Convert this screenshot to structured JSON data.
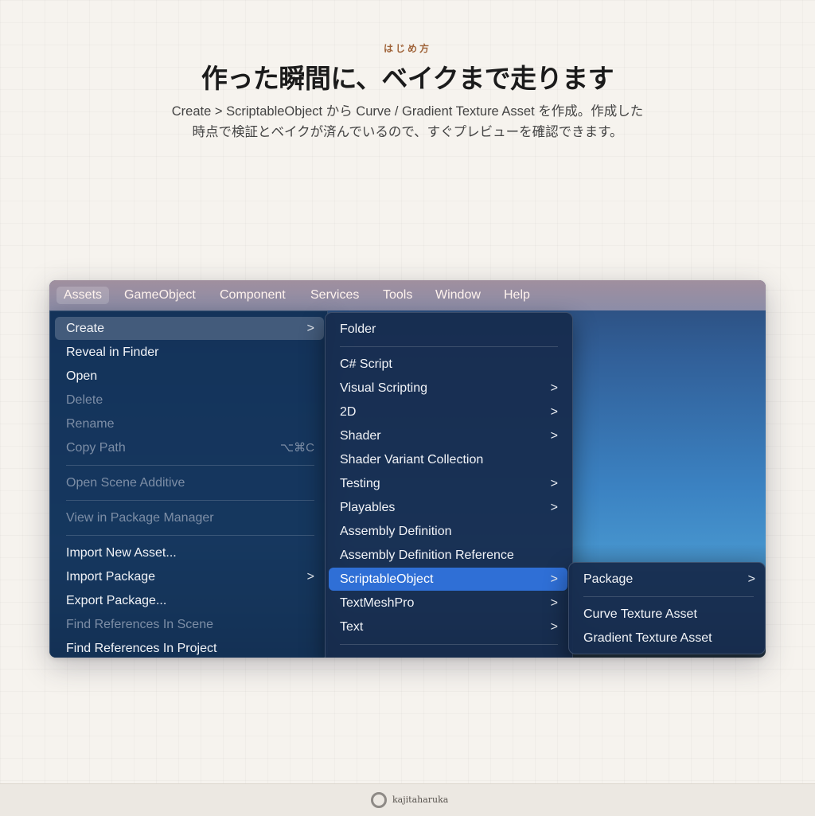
{
  "header": {
    "eyebrow": "はじめ方",
    "headline": "作った瞬間に、ベイクまで走ります",
    "subtitle_line1": "Create > ScriptableObject から Curve / Gradient Texture Asset を作成。作成した",
    "subtitle_line2": "時点で検証とベイクが済んでいるので、すぐプレビューを確認できます。"
  },
  "menubar": {
    "items": [
      "Assets",
      "GameObject",
      "Component",
      "Services",
      "Tools",
      "Window",
      "Help"
    ],
    "active": "Assets"
  },
  "assets_menu": {
    "create": "Create",
    "reveal": "Reveal in Finder",
    "open": "Open",
    "delete": "Delete",
    "rename": "Rename",
    "copy_path": "Copy Path",
    "copy_path_shortcut": "⌥⌘C",
    "open_scene_additive": "Open Scene Additive",
    "view_in_package_manager": "View in Package Manager",
    "import_new_asset": "Import New Asset...",
    "import_package": "Import Package",
    "export_package": "Export Package...",
    "find_refs_scene": "Find References In Scene",
    "find_refs_project": "Find References In Project"
  },
  "create_menu": {
    "folder": "Folder",
    "csharp": "C# Script",
    "visual_scripting": "Visual Scripting",
    "two_d": "2D",
    "shader": "Shader",
    "shader_variant": "Shader Variant Collection",
    "testing": "Testing",
    "playables": "Playables",
    "assembly_def": "Assembly Definition",
    "assembly_def_ref": "Assembly Definition Reference",
    "scriptable_object": "ScriptableObject",
    "textmeshpro": "TextMeshPro",
    "text": "Text"
  },
  "scriptable_menu": {
    "package": "Package",
    "curve_texture": "Curve Texture Asset",
    "gradient_texture": "Gradient Texture Asset"
  },
  "footer": {
    "brand": "kajitaharuka"
  },
  "icons": {
    "submenu": "chevron-right-icon",
    "logo": "ring-logo-icon"
  },
  "colors": {
    "highlight": "#2f6fd6",
    "eyebrow": "#a0643a",
    "menu_bg": "#162c4e"
  }
}
